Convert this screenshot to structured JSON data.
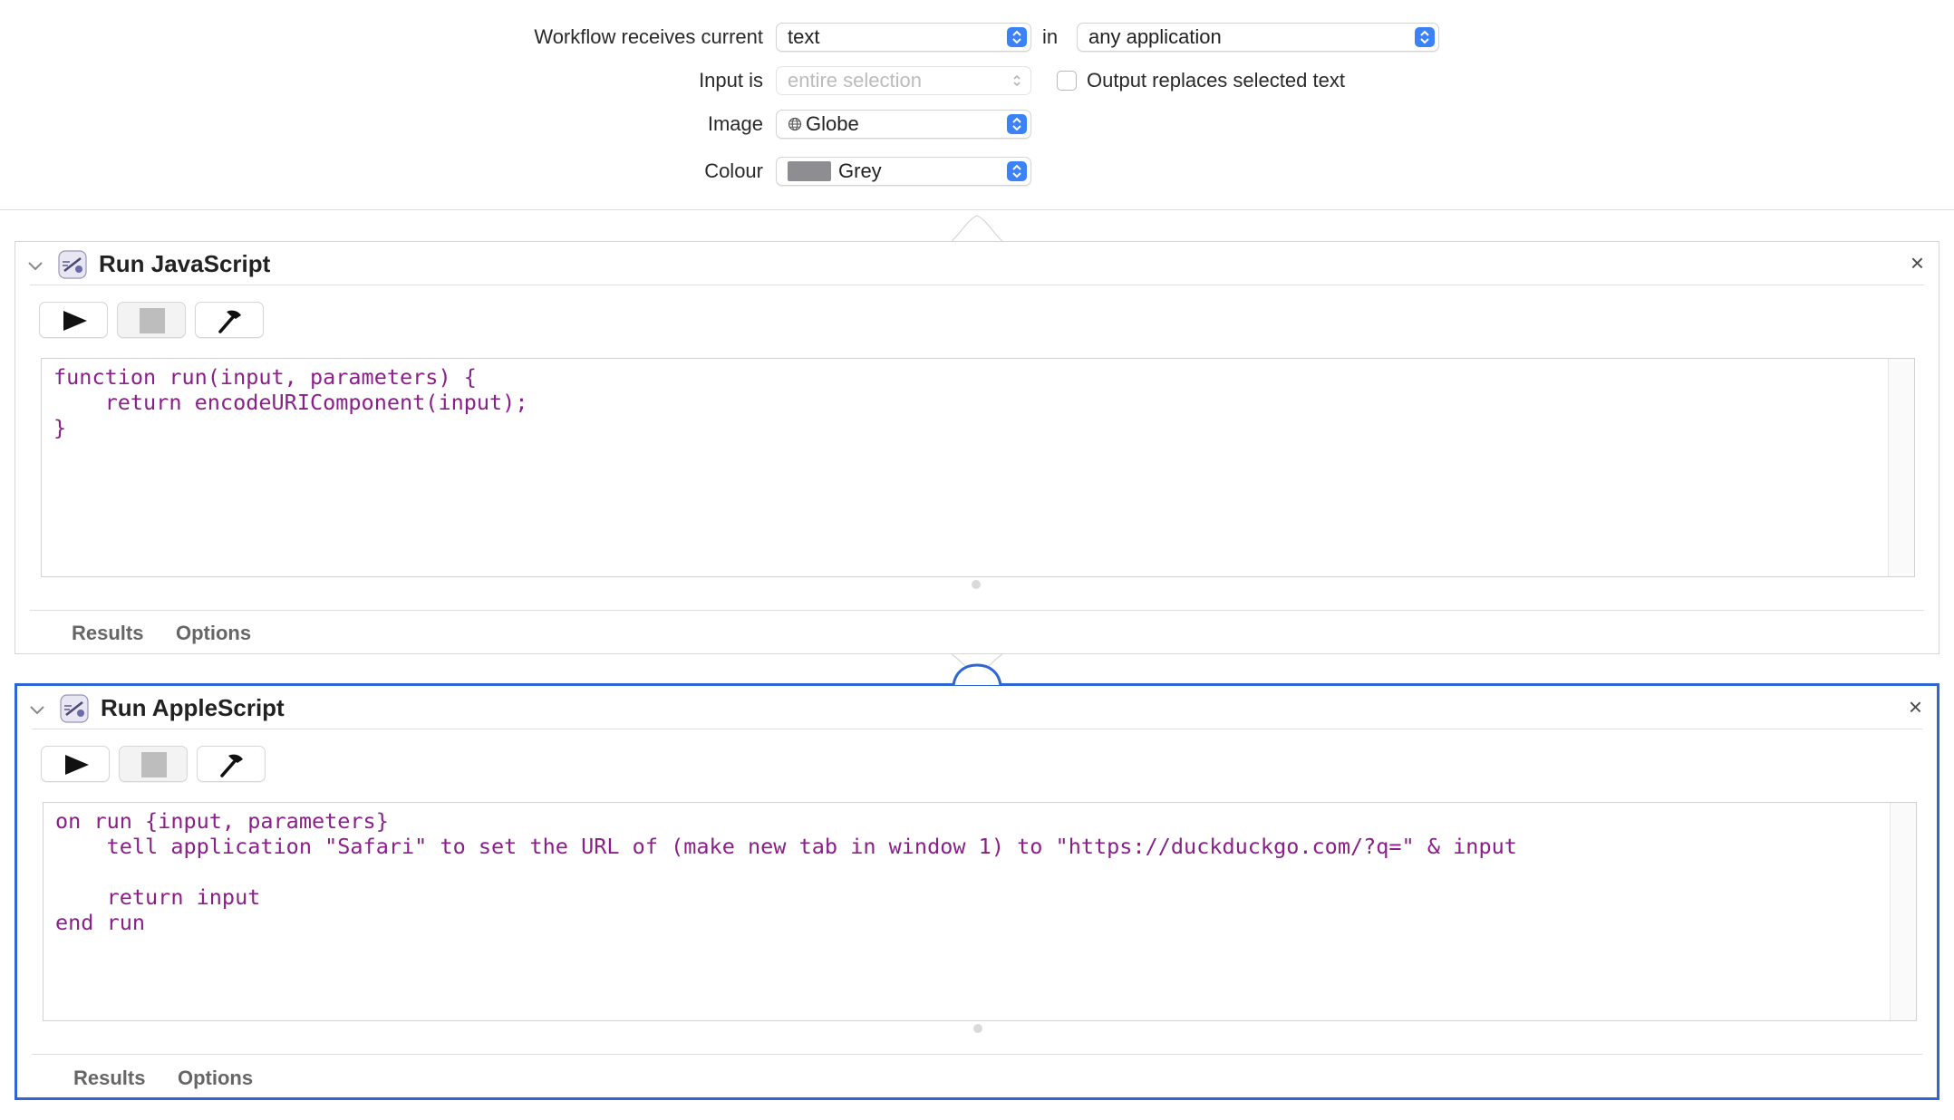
{
  "header": {
    "receives_label": "Workflow receives current",
    "receives_value": "text",
    "in_label": "in",
    "app_value": "any application",
    "input_is_label": "Input is",
    "input_is_value": "entire selection",
    "output_replaces_label": "Output replaces selected text",
    "output_replaces_checked": false,
    "image_label": "Image",
    "image_value": "Globe",
    "image_icon": "globe-icon",
    "colour_label": "Colour",
    "colour_value": "Grey",
    "colour_swatch": "#8e8d92"
  },
  "actions": [
    {
      "title": "Run JavaScript",
      "code": "function run(input, parameters) {\n    return encodeURIComponent(input);\n}",
      "tabs": [
        "Results",
        "Options"
      ],
      "selected": false
    },
    {
      "title": "Run AppleScript",
      "code": "on run {input, parameters}\n    tell application \"Safari\" to set the URL of (make new tab in window 1) to \"https://duckduckgo.com/?q=\" & input\n\n    return input\nend run",
      "tabs": [
        "Results",
        "Options"
      ],
      "selected": true
    }
  ],
  "colors": {
    "accent": "#2f66d6",
    "stepper": "#3b82f6",
    "code": "#8a1f8a"
  }
}
